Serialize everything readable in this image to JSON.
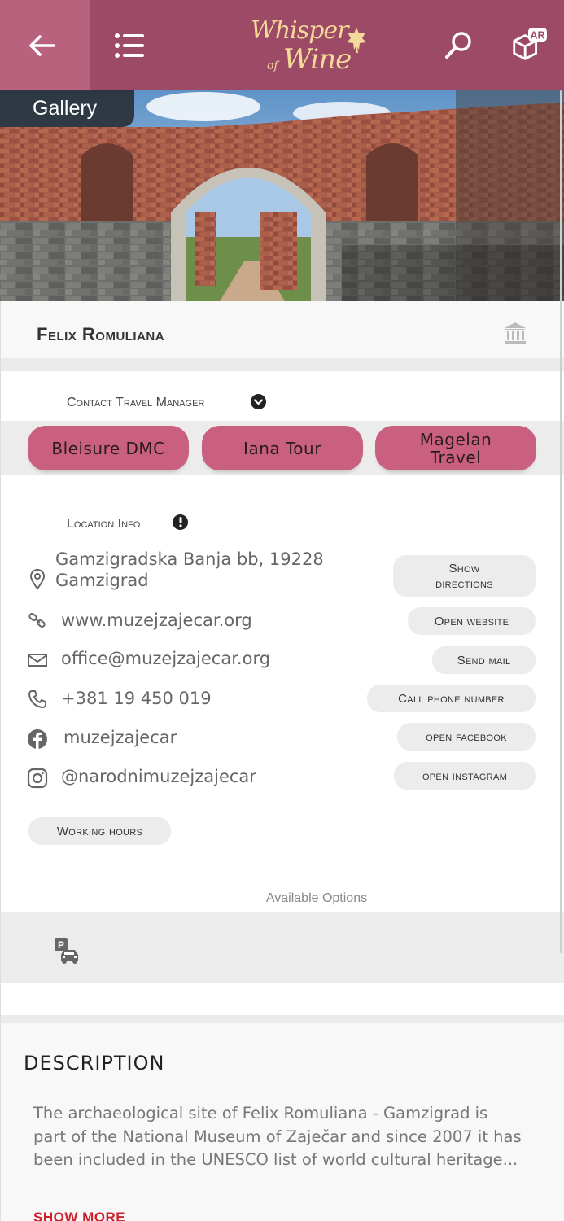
{
  "header": {
    "logo_line1": "Whisper",
    "logo_line2": "Wine",
    "logo_of": "of",
    "ar_badge": "AR",
    "background_color": "#9c4a66",
    "icons": [
      "back-arrow-icon",
      "list-menu-icon",
      "search-icon",
      "ar-cube-icon"
    ]
  },
  "gallery": {
    "label": "Gallery"
  },
  "place": {
    "title": "Felix Romuliana",
    "category_icon": "museum-icon"
  },
  "travel_manager": {
    "label": "Contact Travel Manager",
    "buttons": [
      {
        "label": "Bleisure DMC"
      },
      {
        "label": "Iana Tour"
      },
      {
        "label": "Magelan Travel",
        "line1": "Magelan",
        "line2": "Travel"
      }
    ],
    "button_color": "#c9607f"
  },
  "location": {
    "label": "Location Info",
    "address": "Gamzigradska Banja bb, 19228 Gamzigrad",
    "address_line1": "Gamzigradska Banja bb, 19228",
    "address_line2": "Gamzigrad",
    "show_directions": "Show directions",
    "show_directions_line1": "Show",
    "show_directions_line2": "directions",
    "website": "www.muzejzajecar.org",
    "open_website": "Open website",
    "email": "office@muzejzajecar.org",
    "send_mail": "Send mail",
    "phone": "+381 19 450 019",
    "call_phone": "Call phone number",
    "facebook": "muzejzajecar",
    "open_facebook": "open facebook",
    "instagram": "@narodnimuzejzajecar",
    "open_instagram": "open instagram",
    "working_hours": "Working hours"
  },
  "options": {
    "label": "Available Options",
    "icons": [
      "parking-car-icon"
    ]
  },
  "description": {
    "heading": "DESCRIPTION",
    "text": "The archaeological site of Felix Romuliana - Gamzigrad is part of the National Museum of Zaječar and since 2007 it has been included in the UNESCO list of world cultural heritage...",
    "show_more": "SHOW MORE",
    "show_more_color": "#d0202a"
  }
}
